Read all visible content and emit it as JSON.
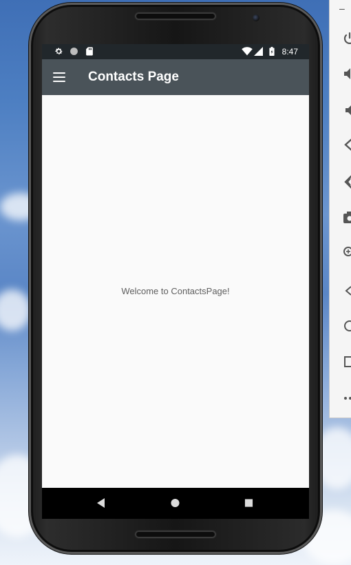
{
  "status_bar": {
    "time": "8:47",
    "left_icons": [
      "settings-icon",
      "circle-icon",
      "sd-card-icon"
    ],
    "right_icons": [
      "wifi-icon",
      "signal-icon",
      "battery-charging-icon"
    ]
  },
  "app_bar": {
    "title": "Contacts Page",
    "menu_icon": "hamburger-menu-icon"
  },
  "content": {
    "welcome_text": "Welcome to ContactsPage!"
  },
  "nav_bar": {
    "buttons": [
      "back-icon",
      "home-icon",
      "recents-icon"
    ]
  },
  "emulator_panel": {
    "minimize_label": "–",
    "icons": [
      "power-icon",
      "volume-up-icon",
      "volume-down-icon",
      "rotate-left-icon",
      "rotate-right-icon",
      "camera-icon",
      "zoom-icon",
      "back-icon",
      "home-icon",
      "overview-icon",
      "more-icon"
    ]
  },
  "colors": {
    "status_bar": "#21272b",
    "app_bar": "#4a5359",
    "content_bg": "#fafafa",
    "nav_bar": "#000000"
  }
}
